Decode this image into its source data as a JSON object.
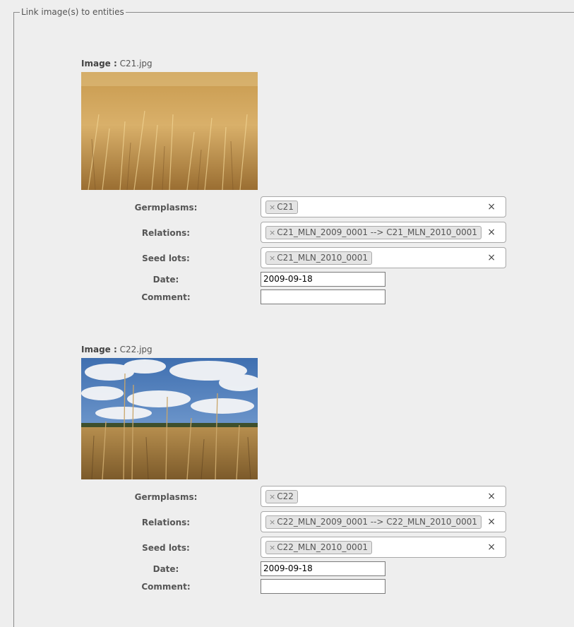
{
  "fieldset": {
    "legend": "Link image(s) to entities"
  },
  "entries": [
    {
      "image_label": "Image :",
      "filename": "C21.jpg",
      "germplasms_label": "Germplasms:",
      "germplasms_tag": "C21",
      "relations_label": "Relations:",
      "relations_tag": "C21_MLN_2009_0001 --> C21_MLN_2010_0001",
      "seedlots_label": "Seed lots:",
      "seedlots_tag": "C21_MLN_2010_0001",
      "date_label": "Date:",
      "date_value": "2009-09-18",
      "comment_label": "Comment:",
      "comment_value": ""
    },
    {
      "image_label": "Image :",
      "filename": "C22.jpg",
      "germplasms_label": "Germplasms:",
      "germplasms_tag": "C22",
      "relations_label": "Relations:",
      "relations_tag": "C22_MLN_2009_0001 --> C22_MLN_2010_0001",
      "seedlots_label": "Seed lots:",
      "seedlots_tag": "C22_MLN_2010_0001",
      "date_label": "Date:",
      "date_value": "2009-09-18",
      "comment_label": "Comment:",
      "comment_value": ""
    }
  ],
  "icons": {
    "tag_remove": "×",
    "clear": "×"
  }
}
